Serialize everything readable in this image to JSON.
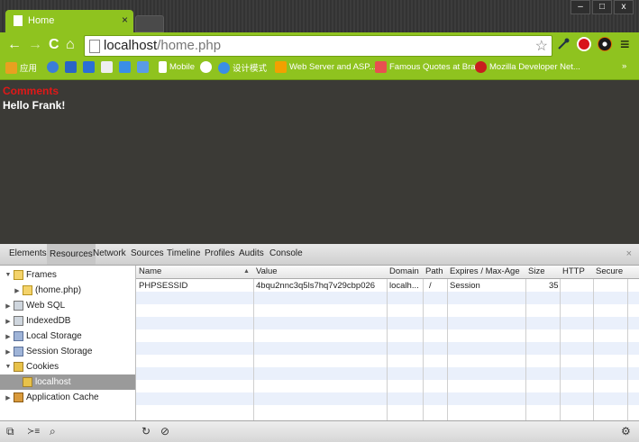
{
  "browser": {
    "tab_title": "Home",
    "tab_close": "×",
    "window_controls": {
      "minimize": "–",
      "maximize": "□",
      "close": "x"
    },
    "nav": {
      "back": "←",
      "forward": "→",
      "reload": "C",
      "home": "⌂"
    },
    "url_host": "localhost",
    "url_path": "/home.php",
    "bookmark_star": "☆",
    "menu_icon": "≡",
    "accent_color": "#8fc31f"
  },
  "bookmarks": [
    {
      "label": "应用",
      "icon": "apps-grid-icon",
      "color": "#e8a020"
    },
    {
      "label": "",
      "icon": "bookmark-icon-1",
      "color": "#3b7dd8"
    },
    {
      "label": "",
      "icon": "bookmark-icon-2",
      "color": "#2a64c5"
    },
    {
      "label": "",
      "icon": "bookmark-icon-b",
      "color": "#2b6fd6"
    },
    {
      "label": "",
      "icon": "bookmark-icon-3",
      "color": "#eeeeee"
    },
    {
      "label": "",
      "icon": "bookmark-icon-4",
      "color": "#3a8ee6"
    },
    {
      "label": "",
      "icon": "bookmark-icon-5",
      "color": "#5a9be6"
    },
    {
      "label": "Mobile",
      "icon": "page-icon",
      "color": "#ffffff"
    },
    {
      "label": "",
      "icon": "bookmark-icon-6",
      "color": "#ffffff"
    },
    {
      "label": "设计模式",
      "icon": "bookmark-icon-7",
      "color": "#3a8ee6"
    },
    {
      "label": "Web Server and ASP....",
      "icon": "bookmark-icon-8",
      "color": "#f2a000"
    },
    {
      "label": "Famous Quotes at Bra...",
      "icon": "bookmark-icon-9",
      "color": "#e85050"
    },
    {
      "label": "Mozilla Developer Net...",
      "icon": "bookmark-icon-10",
      "color": "#c81e1e"
    }
  ],
  "bookmarks_more": "»",
  "page": {
    "comments_label": "Comments",
    "greeting": "Hello Frank!"
  },
  "devtools": {
    "tabs": [
      "Elements",
      "Resources",
      "Network",
      "Sources",
      "Timeline",
      "Profiles",
      "Audits",
      "Console"
    ],
    "active_tab": "Resources",
    "close": "×",
    "sidebar": [
      {
        "label": "Frames",
        "expanded": true,
        "indent": 0,
        "icon": "folder-icon"
      },
      {
        "label": "(home.php)",
        "expanded": false,
        "indent": 1,
        "icon": "folder-icon"
      },
      {
        "label": "Web SQL",
        "expanded": false,
        "indent": 0,
        "icon": "database-icon"
      },
      {
        "label": "IndexedDB",
        "expanded": false,
        "indent": 0,
        "icon": "database-icon"
      },
      {
        "label": "Local Storage",
        "expanded": false,
        "indent": 0,
        "icon": "storage-icon"
      },
      {
        "label": "Session Storage",
        "expanded": false,
        "indent": 0,
        "icon": "storage-icon"
      },
      {
        "label": "Cookies",
        "expanded": true,
        "indent": 0,
        "icon": "cookie-icon"
      },
      {
        "label": "localhost",
        "expanded": null,
        "indent": 1,
        "icon": "cookie-icon",
        "selected": true
      },
      {
        "label": "Application Cache",
        "expanded": false,
        "indent": 0,
        "icon": "cache-icon"
      }
    ],
    "columns": [
      "Name",
      "Value",
      "Domain",
      "Path",
      "Expires / Max-Age",
      "Size",
      "HTTP",
      "Secure"
    ],
    "sort_indicator": "▲",
    "rows": [
      {
        "name": "PHPSESSID",
        "value": "4bqu2nnc3q5ls7hq7v29cbp026",
        "domain": "localh...",
        "path": "/",
        "expires": "Session",
        "size": "35",
        "http": "",
        "secure": ""
      }
    ],
    "status_buttons": {
      "dock": "⧉",
      "console": "≻≡",
      "search": "⌕",
      "refresh": "↻",
      "clear": "⊘",
      "settings": "⚙"
    }
  }
}
